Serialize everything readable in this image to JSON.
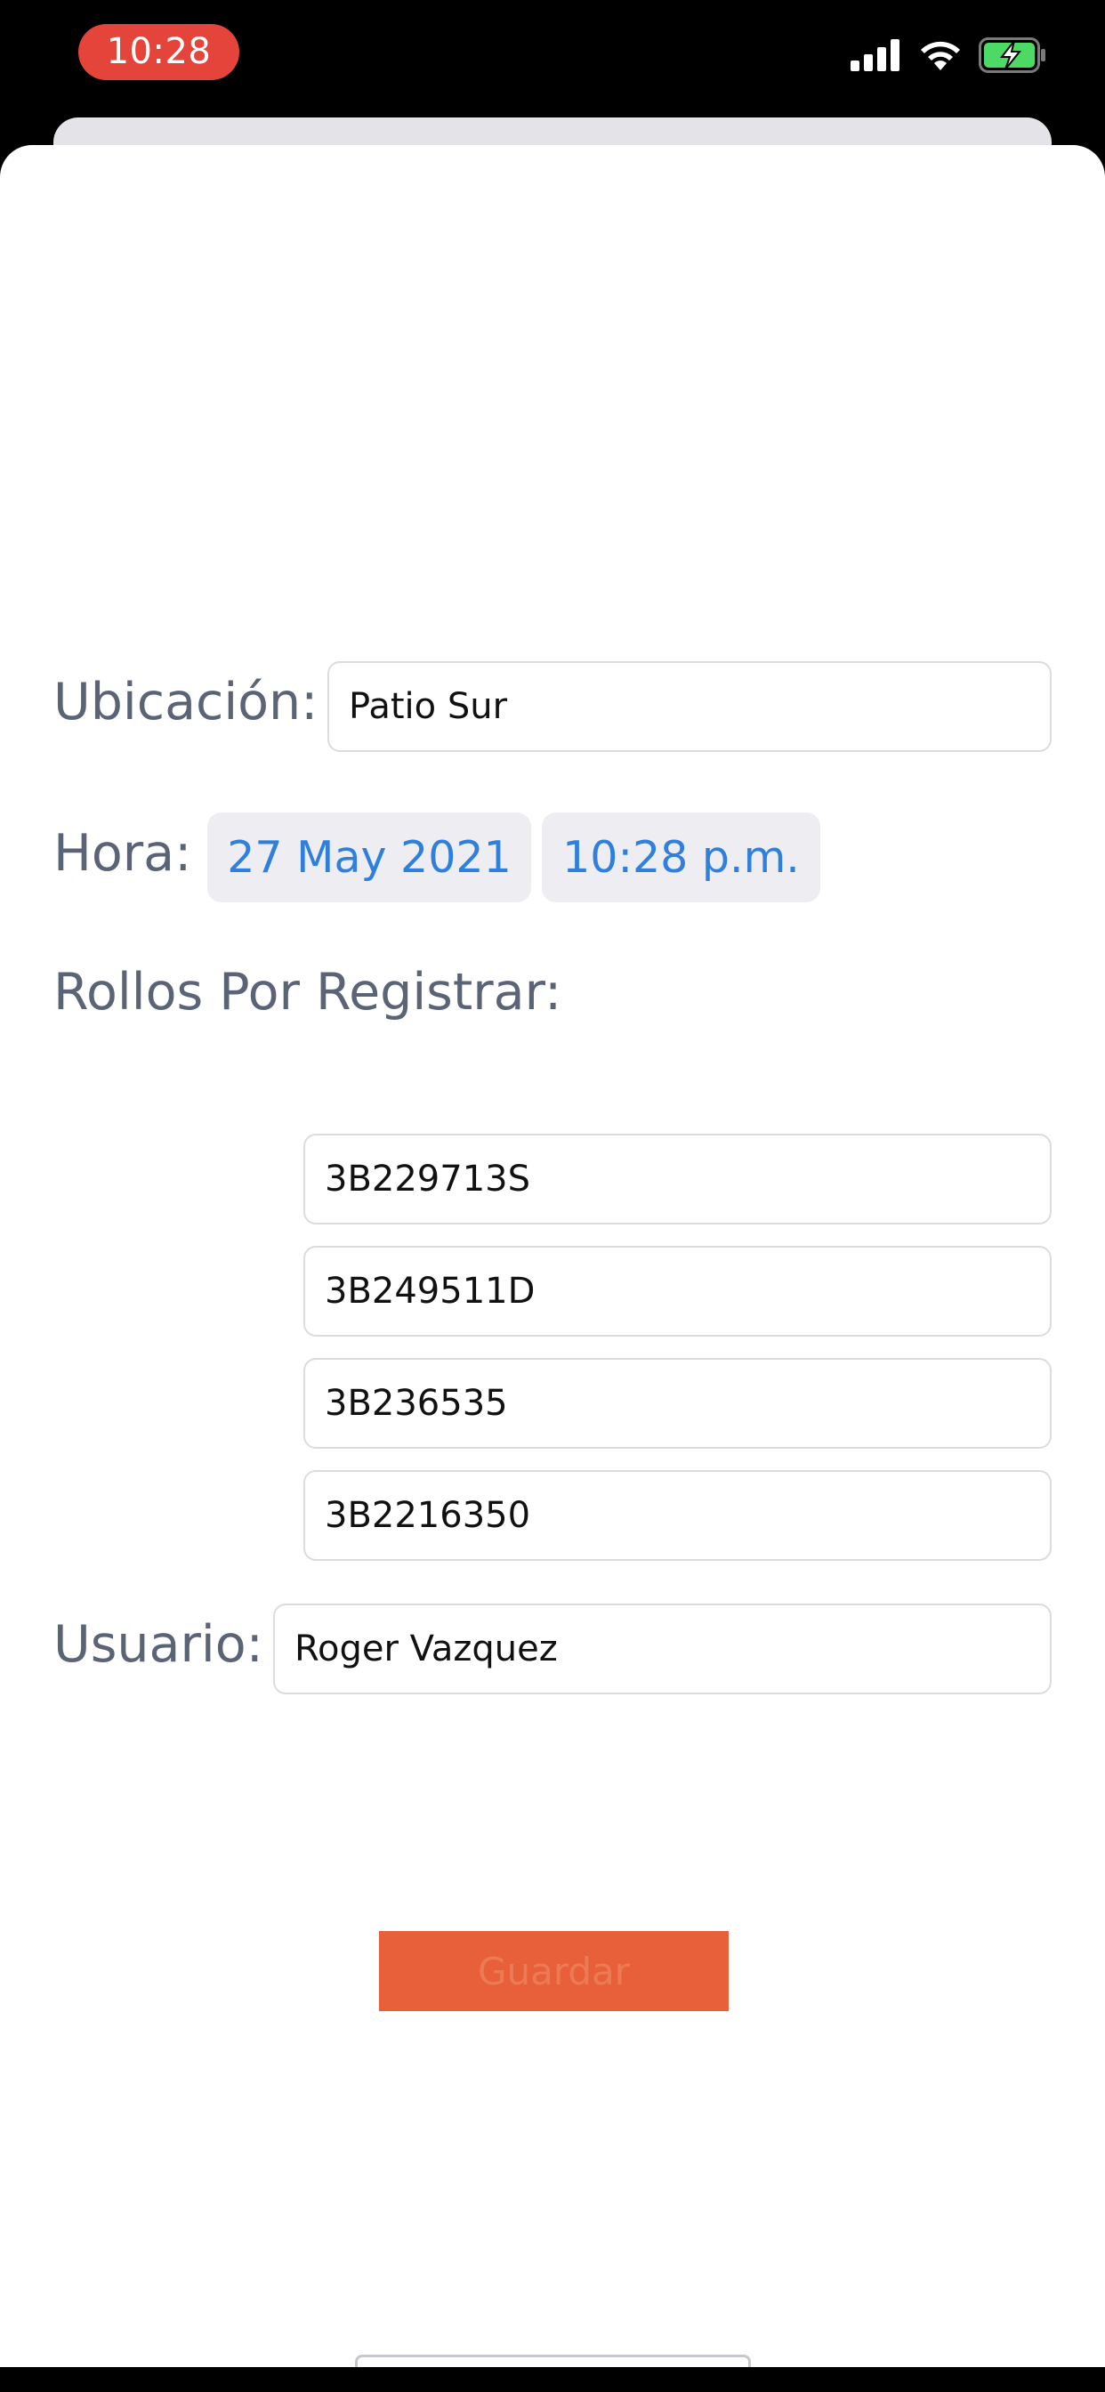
{
  "status_bar": {
    "time": "10:28",
    "icons": [
      "cellular-signal-icon",
      "wifi-icon",
      "battery-charging-icon"
    ],
    "time_pill_color": "#e5443a",
    "battery_color": "#4cd964"
  },
  "form": {
    "location_label": "Ubicación:",
    "location_value": "Patio Sur",
    "time_label": "Hora:",
    "date_value": "27 May 2021",
    "time_value": "10:28 p.m.",
    "rolls_label": "Rollos Por Registrar:",
    "rolls": [
      "3B229713S",
      "3B249511D",
      "3B236535",
      "3B2216350"
    ],
    "user_label": "Usuario:",
    "user_value": "Roger Vazquez"
  },
  "actions": {
    "save_label": "Guardar",
    "save_color": "#e8603a"
  },
  "colors": {
    "label": "#5b6477",
    "accent_blue": "#2f7fdc"
  }
}
